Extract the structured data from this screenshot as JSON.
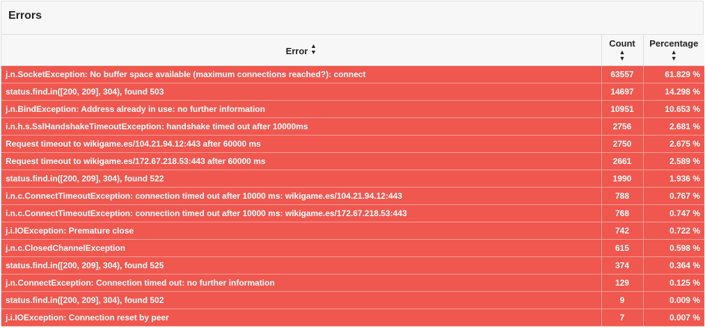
{
  "panel": {
    "title": "Errors"
  },
  "columns": {
    "error": "Error",
    "count": "Count",
    "percentage": "Percentage"
  },
  "colors": {
    "row_bg": "#f0574f",
    "header_bg": "#f7f7f7"
  },
  "rows": [
    {
      "error": "j.n.SocketException: No buffer space available (maximum connections reached?): connect",
      "count": "63557",
      "percentage": "61.829 %"
    },
    {
      "error": "status.find.in([200, 209], 304), found 503",
      "count": "14697",
      "percentage": "14.298 %"
    },
    {
      "error": "j.n.BindException: Address already in use: no further information",
      "count": "10951",
      "percentage": "10.653 %"
    },
    {
      "error": "i.n.h.s.SslHandshakeTimeoutException: handshake timed out after 10000ms",
      "count": "2756",
      "percentage": "2.681 %"
    },
    {
      "error": "Request timeout to wikigame.es/104.21.94.12:443 after 60000 ms",
      "count": "2750",
      "percentage": "2.675 %"
    },
    {
      "error": "Request timeout to wikigame.es/172.67.218.53:443 after 60000 ms",
      "count": "2661",
      "percentage": "2.589 %"
    },
    {
      "error": "status.find.in([200, 209], 304), found 522",
      "count": "1990",
      "percentage": "1.936 %"
    },
    {
      "error": "i.n.c.ConnectTimeoutException: connection timed out after 10000 ms: wikigame.es/104.21.94.12:443",
      "count": "788",
      "percentage": "0.767 %"
    },
    {
      "error": "i.n.c.ConnectTimeoutException: connection timed out after 10000 ms: wikigame.es/172.67.218.53:443",
      "count": "768",
      "percentage": "0.747 %"
    },
    {
      "error": "j.i.IOException: Premature close",
      "count": "742",
      "percentage": "0.722 %"
    },
    {
      "error": "j.n.c.ClosedChannelException",
      "count": "615",
      "percentage": "0.598 %"
    },
    {
      "error": "status.find.in([200, 209], 304), found 525",
      "count": "374",
      "percentage": "0.364 %"
    },
    {
      "error": "j.n.ConnectException: Connection timed out: no further information",
      "count": "129",
      "percentage": "0.125 %"
    },
    {
      "error": "status.find.in([200, 209], 304), found 502",
      "count": "9",
      "percentage": "0.009 %"
    },
    {
      "error": "j.i.IOException: Connection reset by peer",
      "count": "7",
      "percentage": "0.007 %"
    }
  ]
}
